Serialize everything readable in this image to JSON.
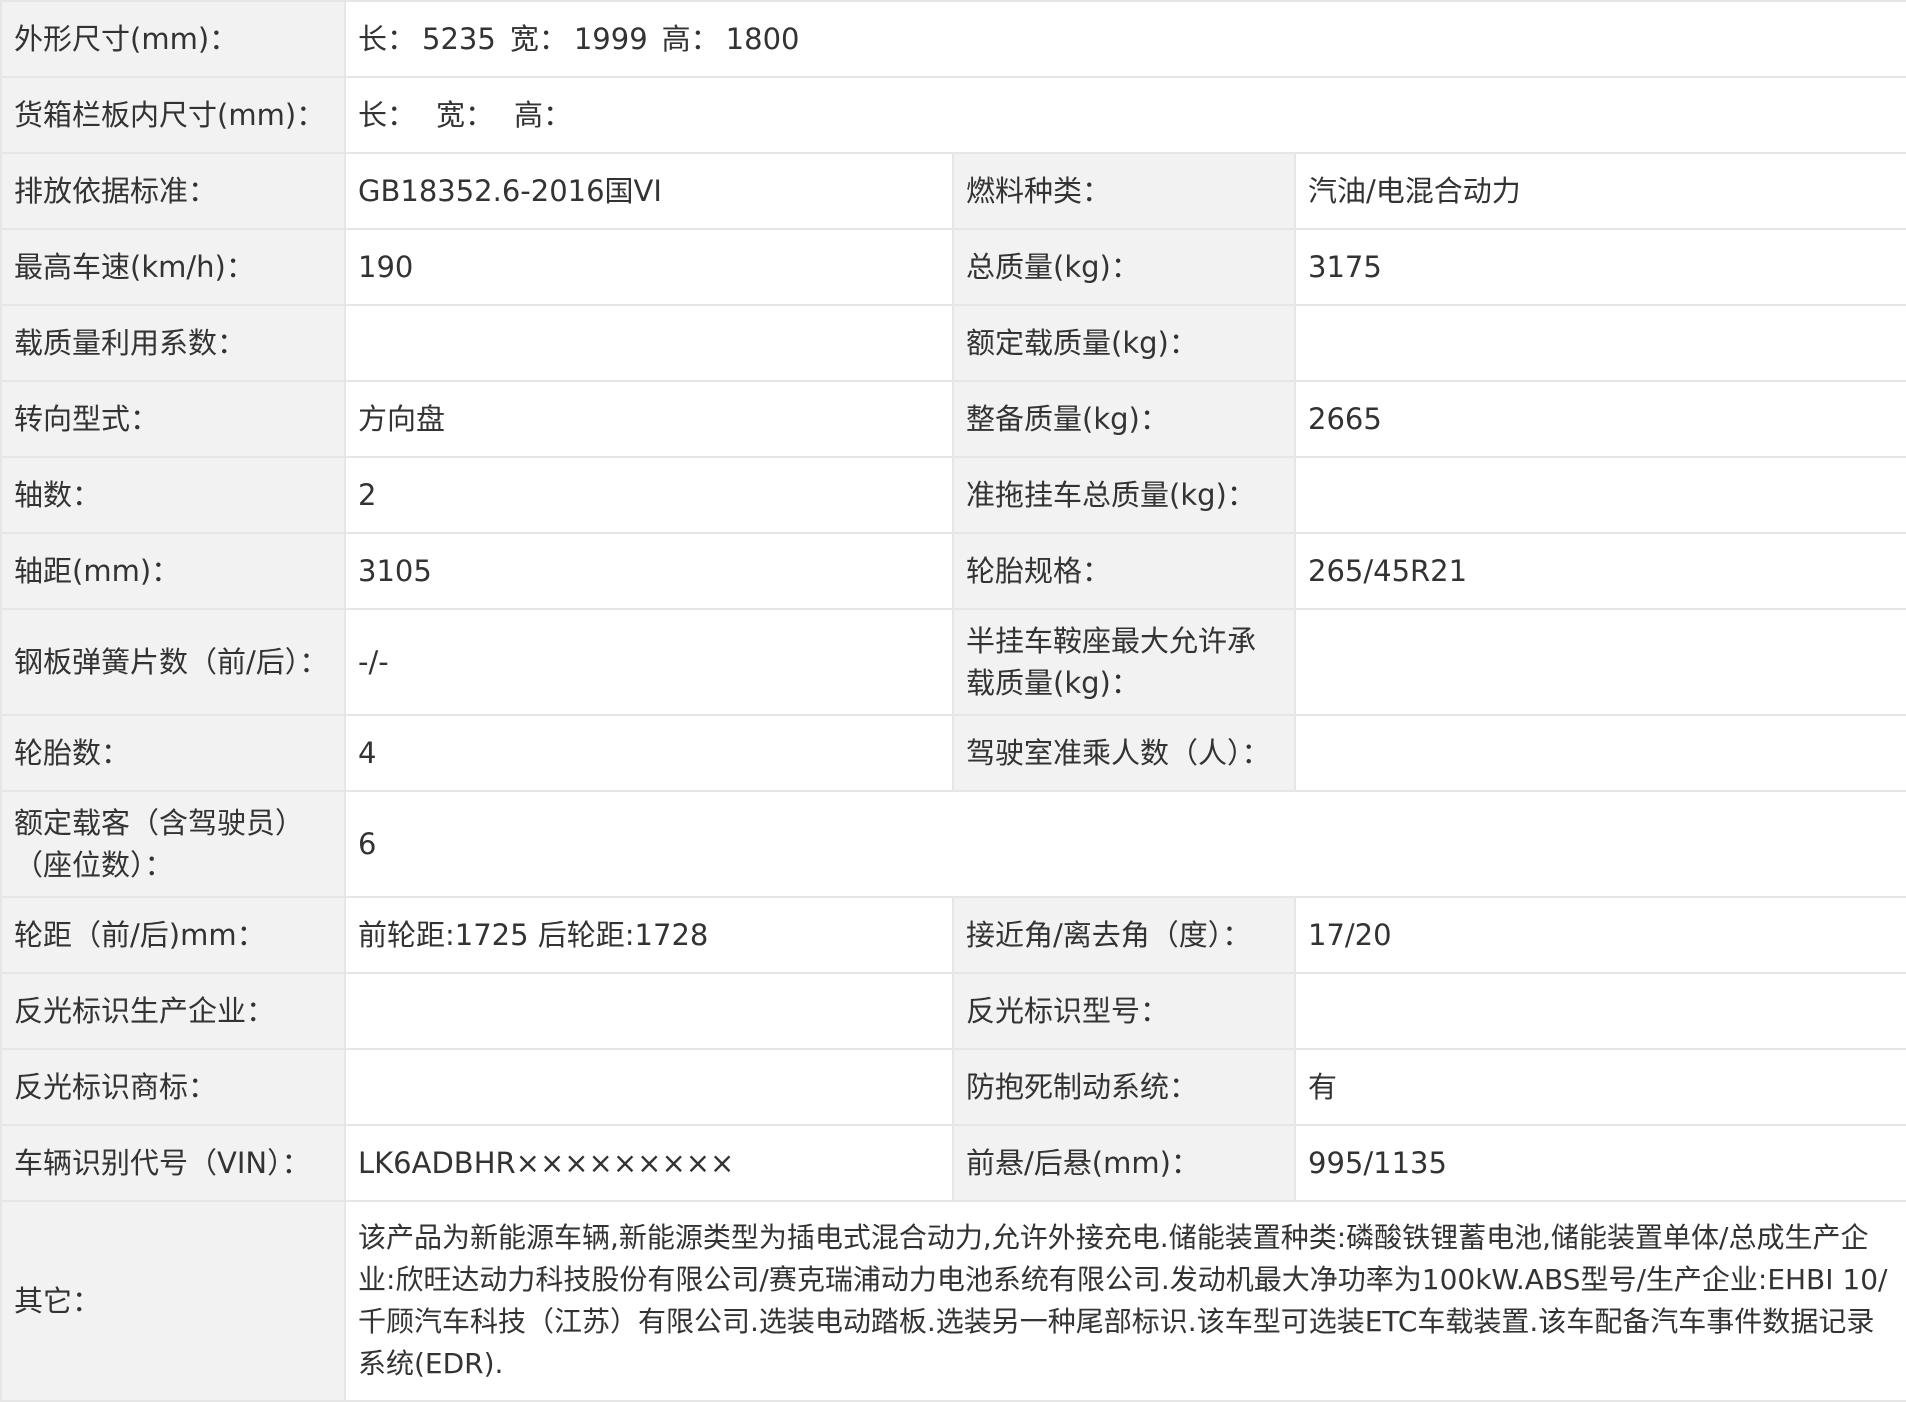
{
  "dimensions": {
    "label": "外形尺寸(mm)：",
    "length_label": "长：",
    "length": "5235",
    "width_label": "宽：",
    "width": "1999",
    "height_label": "高：",
    "height": "1800"
  },
  "cargo_dimensions": {
    "label": "货箱栏板内尺寸(mm)：",
    "length_label": "长：",
    "width_label": "宽：",
    "height_label": "高："
  },
  "rows": [
    {
      "label_left": "排放依据标准：",
      "value_left": "GB18352.6-2016国VI",
      "label_right": "燃料种类：",
      "value_right": "汽油/电混合动力"
    },
    {
      "label_left": "最高车速(km/h)：",
      "value_left": "190",
      "label_right": "总质量(kg)：",
      "value_right": "3175"
    },
    {
      "label_left": "载质量利用系数：",
      "value_left": "",
      "label_right": "额定载质量(kg)：",
      "value_right": ""
    },
    {
      "label_left": "转向型式：",
      "value_left": "方向盘",
      "label_right": "整备质量(kg)：",
      "value_right": "2665"
    },
    {
      "label_left": "轴数：",
      "value_left": "2",
      "label_right": "准拖挂车总质量(kg)：",
      "value_right": ""
    },
    {
      "label_left": "轴距(mm)：",
      "value_left": "3105",
      "label_right": "轮胎规格：",
      "value_right": "265/45R21"
    },
    {
      "label_left": "钢板弹簧片数（前/后）：",
      "value_left": "-/-",
      "label_right": "半挂车鞍座最大允许承载质量(kg)：",
      "value_right": ""
    },
    {
      "label_left": "轮胎数：",
      "value_left": "4",
      "label_right": "驾驶室准乘人数（人）：",
      "value_right": ""
    }
  ],
  "passengers": {
    "label": "额定载客（含驾驶员）（座位数）：",
    "value": "6"
  },
  "rows2": [
    {
      "label_left": "轮距（前/后)mm：",
      "value_left": "前轮距:1725 后轮距:1728",
      "label_right": "接近角/离去角（度）：",
      "value_right": "17/20"
    },
    {
      "label_left": "反光标识生产企业：",
      "value_left": "",
      "label_right": "反光标识型号：",
      "value_right": ""
    },
    {
      "label_left": "反光标识商标：",
      "value_left": "",
      "label_right": "防抱死制动系统：",
      "value_right": "有"
    },
    {
      "label_left": "车辆识别代号（VIN）：",
      "value_left": "LK6ADBHR×××××××××",
      "label_right": "前悬/后悬(mm)：",
      "value_right": "995/1135"
    }
  ],
  "other": {
    "label": "其它：",
    "value": "该产品为新能源车辆,新能源类型为插电式混合动力,允许外接充电.储能装置种类:磷酸铁锂蓄电池,储能装置单体/总成生产企业:欣旺达动力科技股份有限公司/赛克瑞浦动力电池系统有限公司.发动机最大净功率为100kW.ABS型号/生产企业:EHBI 10/千顾汽车科技（江苏）有限公司.选装电动踏板.选装另一种尾部标识.该车型可选装ETC车载装置.该车配备汽车事件数据记录系统(EDR)."
  }
}
